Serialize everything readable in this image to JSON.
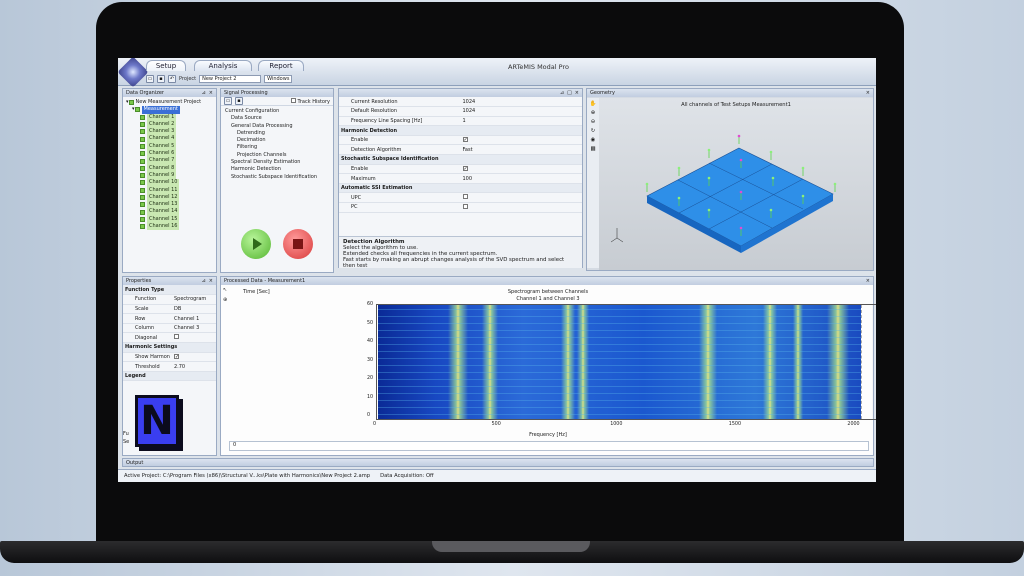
{
  "ribbon": {
    "tabs": [
      "Setup",
      "Analysis",
      "Report"
    ],
    "project_label": "Project",
    "project_value": "New Project 2",
    "windows_label": "Windows"
  },
  "app_title": "ARTeMIS Modal Pro",
  "data_organizer": {
    "title": "Data Organizer",
    "root": "New Measurement Project",
    "measurement": "Measurement",
    "channels": [
      "Channel 1",
      "Channel 2",
      "Channel 3",
      "Channel 4",
      "Channel 5",
      "Channel 6",
      "Channel 7",
      "Channel 8",
      "Channel 9",
      "Channel 10",
      "Channel 11",
      "Channel 12",
      "Channel 13",
      "Channel 14",
      "Channel 15",
      "Channel 16"
    ]
  },
  "signal_processing": {
    "title": "Signal Processing",
    "track_history": "Track History",
    "tree": [
      "Current Configuration",
      "Data Source",
      "General Data Processing",
      "Detrending",
      "Decimation",
      "Filtering",
      "Projection Channels",
      "Spectral Density Estimation",
      "Harmonic Detection",
      "Stochastic Subspace Identification"
    ]
  },
  "settings_grid": {
    "rows": [
      {
        "label": "Current Resolution",
        "value": "1024"
      },
      {
        "label": "Default Resolution",
        "value": "1024"
      },
      {
        "label": "Frequency Line Spacing [Hz]",
        "value": "1"
      }
    ],
    "harmonic_section": "Harmonic Detection",
    "harmonic_rows": [
      {
        "label": "Enable",
        "value": "checked"
      },
      {
        "label": "Detection Algorithm",
        "value": "Fast"
      }
    ],
    "ssi_section": "Stochastic Subspace Identification",
    "ssi_rows": [
      {
        "label": "Enable",
        "value": "checked"
      },
      {
        "label": "Maximum",
        "value": "100"
      }
    ],
    "auto_section": "Automatic SSI Estimation",
    "auto_rows": [
      {
        "label": "UPC",
        "value": ""
      },
      {
        "label": "PC",
        "value": ""
      }
    ]
  },
  "help": {
    "title": "Detection Algorithm",
    "line1": "Select the algorithm to use.",
    "line2": "Extended checks all frequencies in the current spectrum.",
    "line3": "Fast starts by making an abrupt changes analysis of the SVD spectrum and select then test"
  },
  "geometry": {
    "title": "Geometry",
    "heading": "All channels of Test Setups Measurement1"
  },
  "properties": {
    "title": "Properties",
    "section1": "Function Type",
    "rows": [
      {
        "label": "Function",
        "value": "Spectrogram"
      },
      {
        "label": "Scale",
        "value": "DB"
      },
      {
        "label": "Row",
        "value": "Channel 1"
      },
      {
        "label": "Column",
        "value": "Channel 3"
      },
      {
        "label": "Diagonal",
        "value": ""
      }
    ],
    "section2": "Harmonic Settings",
    "rows2": [
      {
        "label": "Show Harmon",
        "value": "checked"
      },
      {
        "label": "Threshold",
        "value": "2.70"
      }
    ],
    "section3": "Legend",
    "footer1": "Fu",
    "footer2": "Se"
  },
  "spectrogram": {
    "title": "Processed Data - Measurement1",
    "ylabel": "Time [Sec]",
    "chart_title": "Spectrogram between Channels",
    "subtitle": "Channel 1 and Channel 3",
    "xlabel": "Frequency [Hz]",
    "x_ticks": [
      "0",
      "500",
      "1000",
      "1500",
      "2000",
      "2500"
    ],
    "y_ticks": [
      "60",
      "50",
      "40",
      "30",
      "20",
      "10",
      "0"
    ],
    "slider_value": "0"
  },
  "output": {
    "title": "Output"
  },
  "status": {
    "active_project": "Active Project: C:\\Program Files (x86)\\Structural V...ks\\Plate with Harmonics\\New Project 2.amp",
    "acquisition": "Data Acquisition: Off"
  },
  "logo": {
    "letter": "N"
  },
  "colors": {
    "accent": "#3a6fd6",
    "plate": "#2f8ee6"
  }
}
